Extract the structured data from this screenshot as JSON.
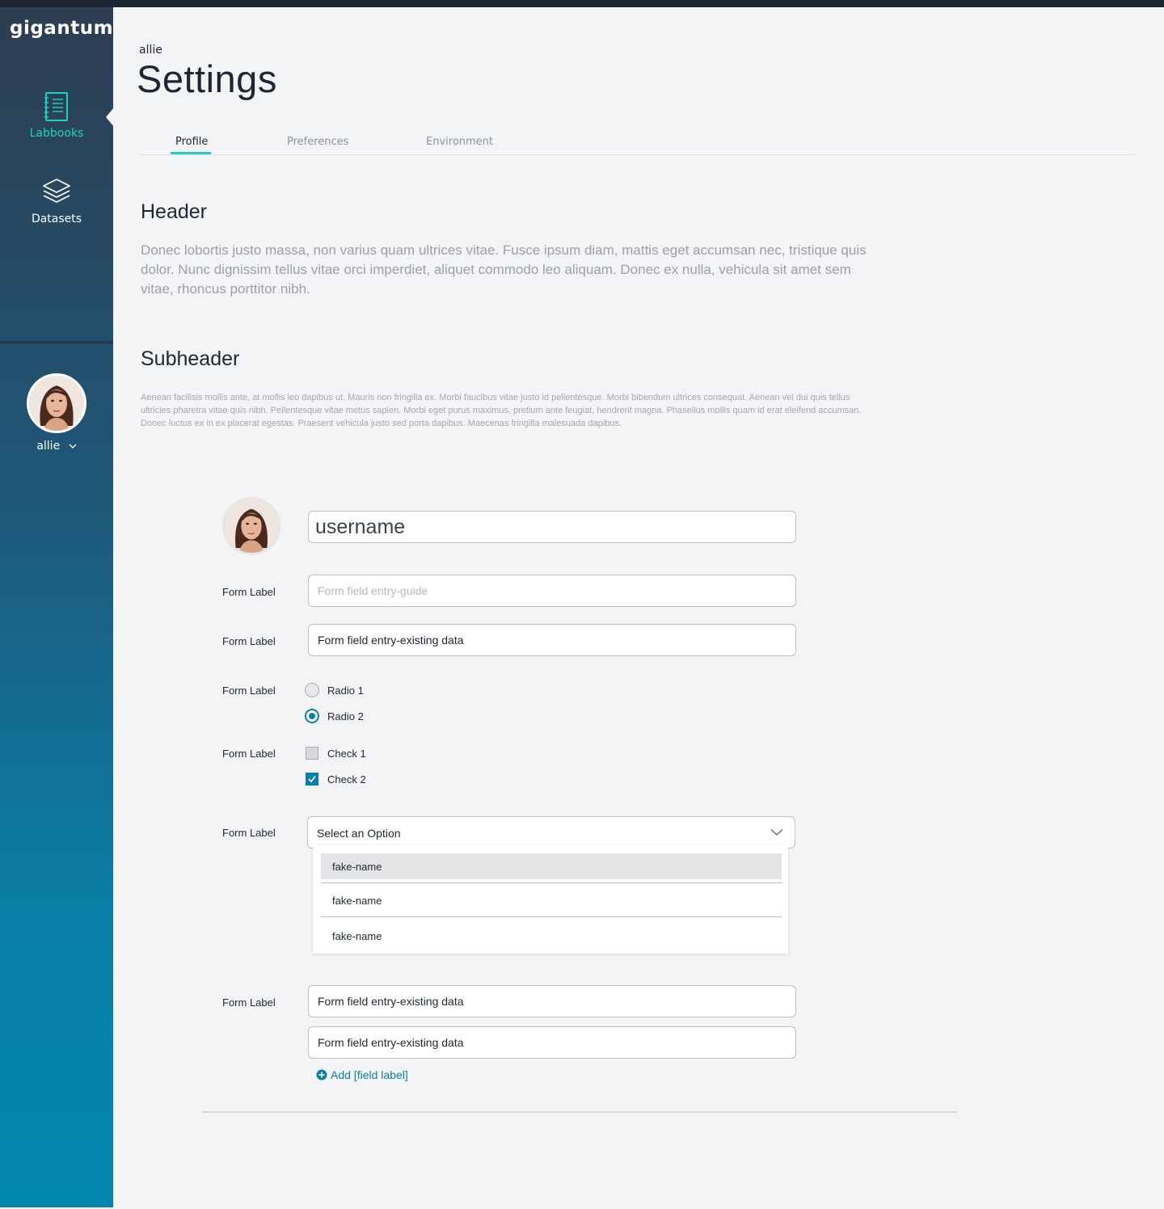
{
  "app": {
    "logo": "gigantum"
  },
  "sidebar": {
    "items": [
      {
        "label": "Labbooks",
        "icon": "notebook-icon",
        "active": true
      },
      {
        "label": "Datasets",
        "icon": "layers-icon",
        "active": false
      }
    ],
    "user": {
      "name": "allie"
    }
  },
  "page": {
    "breadcrumb": "allie",
    "title": "Settings",
    "tabs": [
      {
        "label": "Profile",
        "active": true
      },
      {
        "label": "Preferences",
        "active": false
      },
      {
        "label": "Environment",
        "active": false
      }
    ]
  },
  "content": {
    "header": "Header",
    "header_text": "Donec lobortis justo massa, non varius quam ultrices vitae. Fusce ipsum diam, mattis eget accumsan nec, tristique quis dolor. Nunc dignissim tellus vitae orci imperdiet, aliquet commodo leo aliquam. Donec ex nulla, vehicula sit amet sem vitae, rhoncus porttitor nibh.",
    "subheader": "Subheader",
    "subheader_text": "Aenean facilisis mollis ante, at mollis leo dapibus ut. Mauris non fringilla ex. Morbi faucibus vitae justo id pellentesque. Morbi bibendum ultrices consequat. Aenean vel dui quis tellus ultricies pharetra vitae quis nibh. Pellentesque vitae metus sapien. Morbi eget purus maximus, pretium ante feugiat, hendrerit magna. Phasellus mollis quam id erat eleifend accumsan. Donec luctus ex in ex placerat egestas. Praesent vehicula justo sed porta dapibus. Maecenas fringilla malesuada dapibus."
  },
  "form": {
    "username": "username",
    "label": "Form Label",
    "placeholder_field": "Form field entry-guide",
    "existing_value": "Form field entry-existing data",
    "radios": [
      {
        "label": "Radio 1",
        "checked": false
      },
      {
        "label": "Radio 2",
        "checked": true
      }
    ],
    "checks": [
      {
        "label": "Check 1",
        "checked": false
      },
      {
        "label": "Check 2",
        "checked": true
      }
    ],
    "select": {
      "placeholder": "Select an Option",
      "options": [
        "fake-name",
        "fake-name",
        "fake-name"
      ]
    },
    "multi_values": [
      "Form field entry-existing data",
      "Form field entry-existing data"
    ],
    "add_link": "Add [field label]"
  },
  "colors": {
    "accent_teal": "#1fd1bd",
    "accent_blue": "#0a7ea6",
    "text_dark": "#1d2733"
  }
}
